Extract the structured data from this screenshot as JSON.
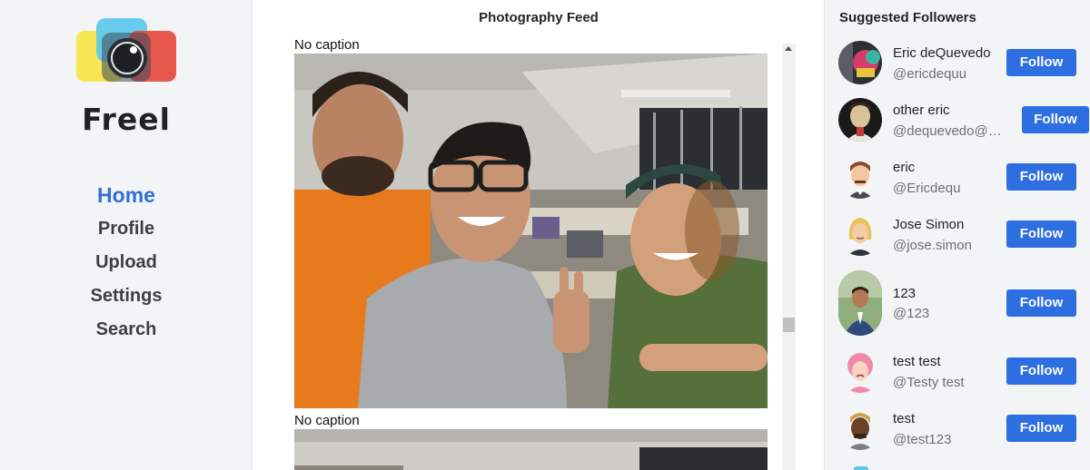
{
  "brand": {
    "name": "Freel"
  },
  "nav": {
    "items": [
      {
        "label": "Home",
        "active": true
      },
      {
        "label": "Profile"
      },
      {
        "label": "Upload"
      },
      {
        "label": "Settings"
      },
      {
        "label": "Search"
      }
    ]
  },
  "feed": {
    "title": "Photography Feed",
    "posts": [
      {
        "caption": "No caption",
        "image": "group-selfie-photo"
      },
      {
        "caption": "No caption",
        "image": "office-ceiling-photo"
      }
    ]
  },
  "suggested": {
    "title": "Suggested Followers",
    "follow_label": "Follow",
    "users": [
      {
        "name": "Eric deQuevedo",
        "handle": "@ericdequu",
        "avatar": "abstract-avatar"
      },
      {
        "name": "other eric",
        "handle": "@dequevedo@gmail.com",
        "avatar": "portrait-avatar"
      },
      {
        "name": "eric",
        "handle": "@Ericdequ",
        "avatar": "cartoon-man-avatar"
      },
      {
        "name": "Jose Simon",
        "handle": "@jose.simon",
        "avatar": "cartoon-woman-avatar"
      },
      {
        "name": "123",
        "handle": "@123",
        "avatar": "photo-man-avatar"
      },
      {
        "name": "test test",
        "handle": "@Testy test",
        "avatar": "cartoon-pink-avatar"
      },
      {
        "name": "test",
        "handle": "@test123",
        "avatar": "cartoon-dark-avatar"
      }
    ]
  },
  "colors": {
    "accent": "#2d6ee0",
    "nav_active": "#2f6fd8",
    "sidebar_bg": "#f3f4f6"
  }
}
